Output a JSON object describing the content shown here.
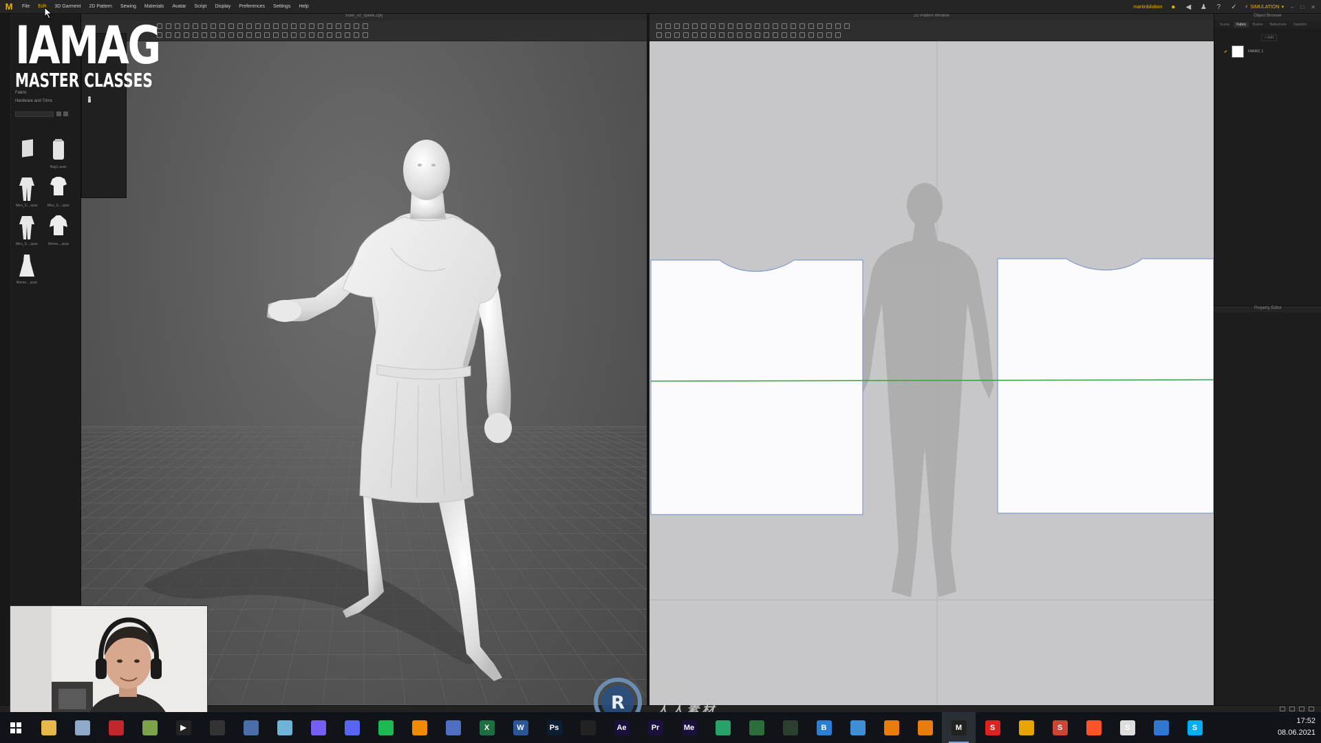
{
  "menubar": {
    "app_logo": "M",
    "items": [
      "File",
      "Edit",
      "3D Garment",
      "2D Pattern",
      "Sewing",
      "Materials",
      "Avatar",
      "Script",
      "Display",
      "Preferences",
      "Settings",
      "Help"
    ],
    "active_item": "Edit",
    "user": "martinbilobon",
    "mode": "SIMULATION"
  },
  "library": {
    "labels": [
      "Fabric",
      "Hardware and Trims"
    ],
    "thumbnails": [
      {
        "caption": "",
        "icon": "fabric-folder-icon"
      },
      {
        "caption": "Bag1.avac",
        "icon": "bag-icon"
      },
      {
        "caption": "Men_S....zpac",
        "icon": "suit-icon"
      },
      {
        "caption": "Men_S....zpac",
        "icon": "shirt-icon"
      },
      {
        "caption": "Men_S....zpac",
        "icon": "suit-icon"
      },
      {
        "caption": "Wome....zpac",
        "icon": "blouse-icon"
      },
      {
        "caption": "Wome....zpac",
        "icon": "dress-icon"
      }
    ]
  },
  "viewport3d": {
    "title": "Scen_v2_speek.Zprj"
  },
  "pattern2d": {
    "title": "2D Pattern Window"
  },
  "right_panel": {
    "object_browser_title": "Object Browser",
    "tabs": [
      "Scene",
      "Fabric",
      "Button",
      "Buttonhole",
      "Topstitch"
    ],
    "active_tab": "Fabric",
    "add_label": "+ Add",
    "fabric_item": "FABRIC 1",
    "property_editor_title": "Property Editor"
  },
  "watermark": {
    "big": "IAMAG",
    "small": "MASTER CLASSES"
  },
  "rrcg": {
    "text": "RRCG",
    "sub": "人人素材"
  },
  "taskbar": {
    "apps": [
      {
        "name": "file-explorer",
        "glyph": "",
        "color": "#e6b84a"
      },
      {
        "name": "control-panel",
        "glyph": "",
        "color": "#8fa9c9"
      },
      {
        "name": "flame-app",
        "glyph": "",
        "color": "#c0262b"
      },
      {
        "name": "fruit-app",
        "glyph": "",
        "color": "#7da34a"
      },
      {
        "name": "media-player",
        "glyph": "▶",
        "color": "#222"
      },
      {
        "name": "obs-studio",
        "glyph": "",
        "color": "#333"
      },
      {
        "name": "calculator",
        "glyph": "",
        "color": "#4a6ea8"
      },
      {
        "name": "notes",
        "glyph": "",
        "color": "#6fb3d9"
      },
      {
        "name": "viber",
        "glyph": "",
        "color": "#7360f2"
      },
      {
        "name": "discord",
        "glyph": "",
        "color": "#5865f2"
      },
      {
        "name": "spotify",
        "glyph": "",
        "color": "#1db954"
      },
      {
        "name": "vlc",
        "glyph": "",
        "color": "#f08a00"
      },
      {
        "name": "save-app",
        "glyph": "",
        "color": "#4e6fc2"
      },
      {
        "name": "excel",
        "glyph": "X",
        "color": "#1d6f42"
      },
      {
        "name": "word",
        "glyph": "W",
        "color": "#2b5797"
      },
      {
        "name": "photoshop",
        "glyph": "Ps",
        "color": "#0b1e33"
      },
      {
        "name": "search-app",
        "glyph": "",
        "color": "#222"
      },
      {
        "name": "after-effects",
        "glyph": "Ae",
        "color": "#1b0f3d"
      },
      {
        "name": "premiere",
        "glyph": "Pr",
        "color": "#1b0f3d"
      },
      {
        "name": "media-encoder",
        "glyph": "Me",
        "color": "#1b0f3d"
      },
      {
        "name": "feather-app",
        "glyph": "",
        "color": "#27a36a"
      },
      {
        "name": "monitor-app",
        "glyph": "",
        "color": "#2c6e3a"
      },
      {
        "name": "target-app",
        "glyph": "",
        "color": "#2c3e2d"
      },
      {
        "name": "b-app",
        "glyph": "B",
        "color": "#2a7fd4"
      },
      {
        "name": "blender-like",
        "glyph": "",
        "color": "#3f8fd6"
      },
      {
        "name": "blender",
        "glyph": "",
        "color": "#e87d0d"
      },
      {
        "name": "blender-2",
        "glyph": "",
        "color": "#e87d0d"
      },
      {
        "name": "marvelous-designer",
        "glyph": "M",
        "color": "#222",
        "active": true
      },
      {
        "name": "s-red-app",
        "glyph": "S",
        "color": "#d22"
      },
      {
        "name": "triangle-app",
        "glyph": "",
        "color": "#e8a500"
      },
      {
        "name": "s-app-2",
        "glyph": "S",
        "color": "#c43"
      },
      {
        "name": "brave",
        "glyph": "",
        "color": "#fb542b"
      },
      {
        "name": "s-app-3",
        "glyph": "S",
        "color": "#ddd"
      },
      {
        "name": "photos",
        "glyph": "",
        "color": "#2f77d1"
      },
      {
        "name": "skype",
        "glyph": "S",
        "color": "#00aff0"
      }
    ]
  },
  "clock": {
    "time": "17:52",
    "date": "08.06.2021"
  }
}
